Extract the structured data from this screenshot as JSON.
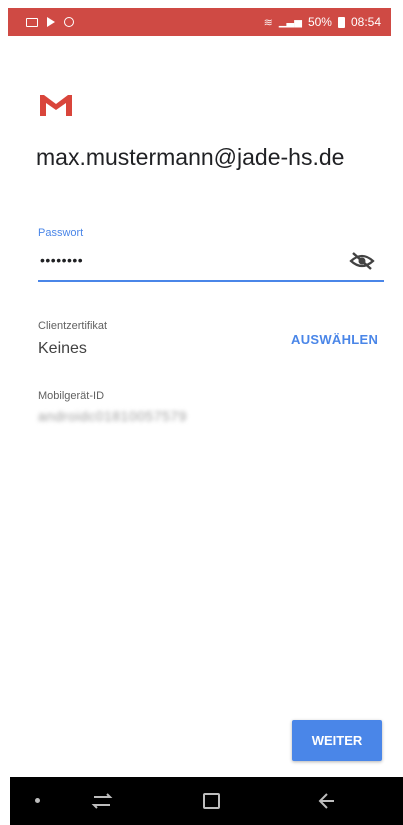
{
  "status_bar": {
    "icons": [
      "image-icon",
      "play-icon",
      "sync-icon"
    ],
    "signal_icons": [
      "wifi-icon",
      "signal-icon",
      "battery-icon"
    ],
    "battery": "50%",
    "time": "08:54"
  },
  "account": {
    "logo": "gmail-logo",
    "email": "max.mustermann@jade-hs.de"
  },
  "password": {
    "label": "Passwort",
    "value": "••••••••",
    "toggle_icon": "visibility-off-icon"
  },
  "certificate": {
    "label": "Clientzertifikat",
    "value": "Keines",
    "action": "AUSWÄHLEN"
  },
  "device": {
    "label": "Mobilgerät-ID",
    "value": "androidc01810057579"
  },
  "footer": {
    "next_label": "WEITER"
  },
  "nav_bar": {
    "icons": [
      "dot-icon",
      "recents-icon",
      "home-icon",
      "back-icon"
    ]
  },
  "colors": {
    "status_bar": "#cf4a44",
    "accent": "#4a86e8",
    "gmail_red": "#d9453b"
  }
}
